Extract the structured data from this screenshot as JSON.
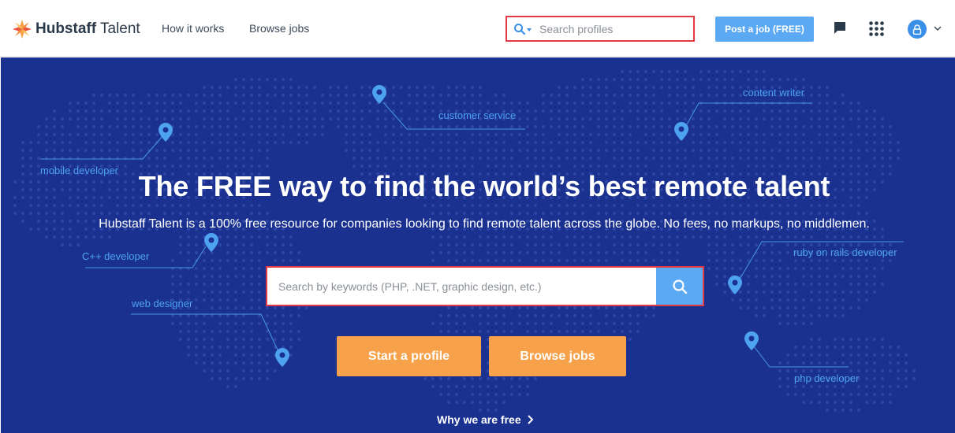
{
  "header": {
    "logo": {
      "brand": "Hubstaff",
      "product": "Talent"
    },
    "nav": [
      {
        "label": "How it works"
      },
      {
        "label": "Browse jobs"
      }
    ],
    "search": {
      "placeholder": "Search profiles"
    },
    "post_job_label": "Post a job (FREE)"
  },
  "hero": {
    "title": "The FREE way to find the world’s best remote talent",
    "subtitle": "Hubstaff Talent is a 100% free resource for companies looking to find remote talent across the globe. No fees, no markups, no middlemen.",
    "search": {
      "placeholder": "Search by keywords (PHP, .NET, graphic design, etc.)"
    },
    "cta_start": "Start a profile",
    "cta_browse": "Browse jobs",
    "why_free": "Why we are free",
    "map_tags": [
      "mobile developer",
      "customer service",
      "content writer",
      "C++ developer",
      "ruby on rails developer",
      "web designer",
      "php developer"
    ]
  },
  "colors": {
    "hero_bg": "#1a3190",
    "accent_blue": "#5aa9f2",
    "cta_orange": "#f7a24a",
    "highlight_red": "#e23a45",
    "tag_blue": "#4da3ee"
  }
}
